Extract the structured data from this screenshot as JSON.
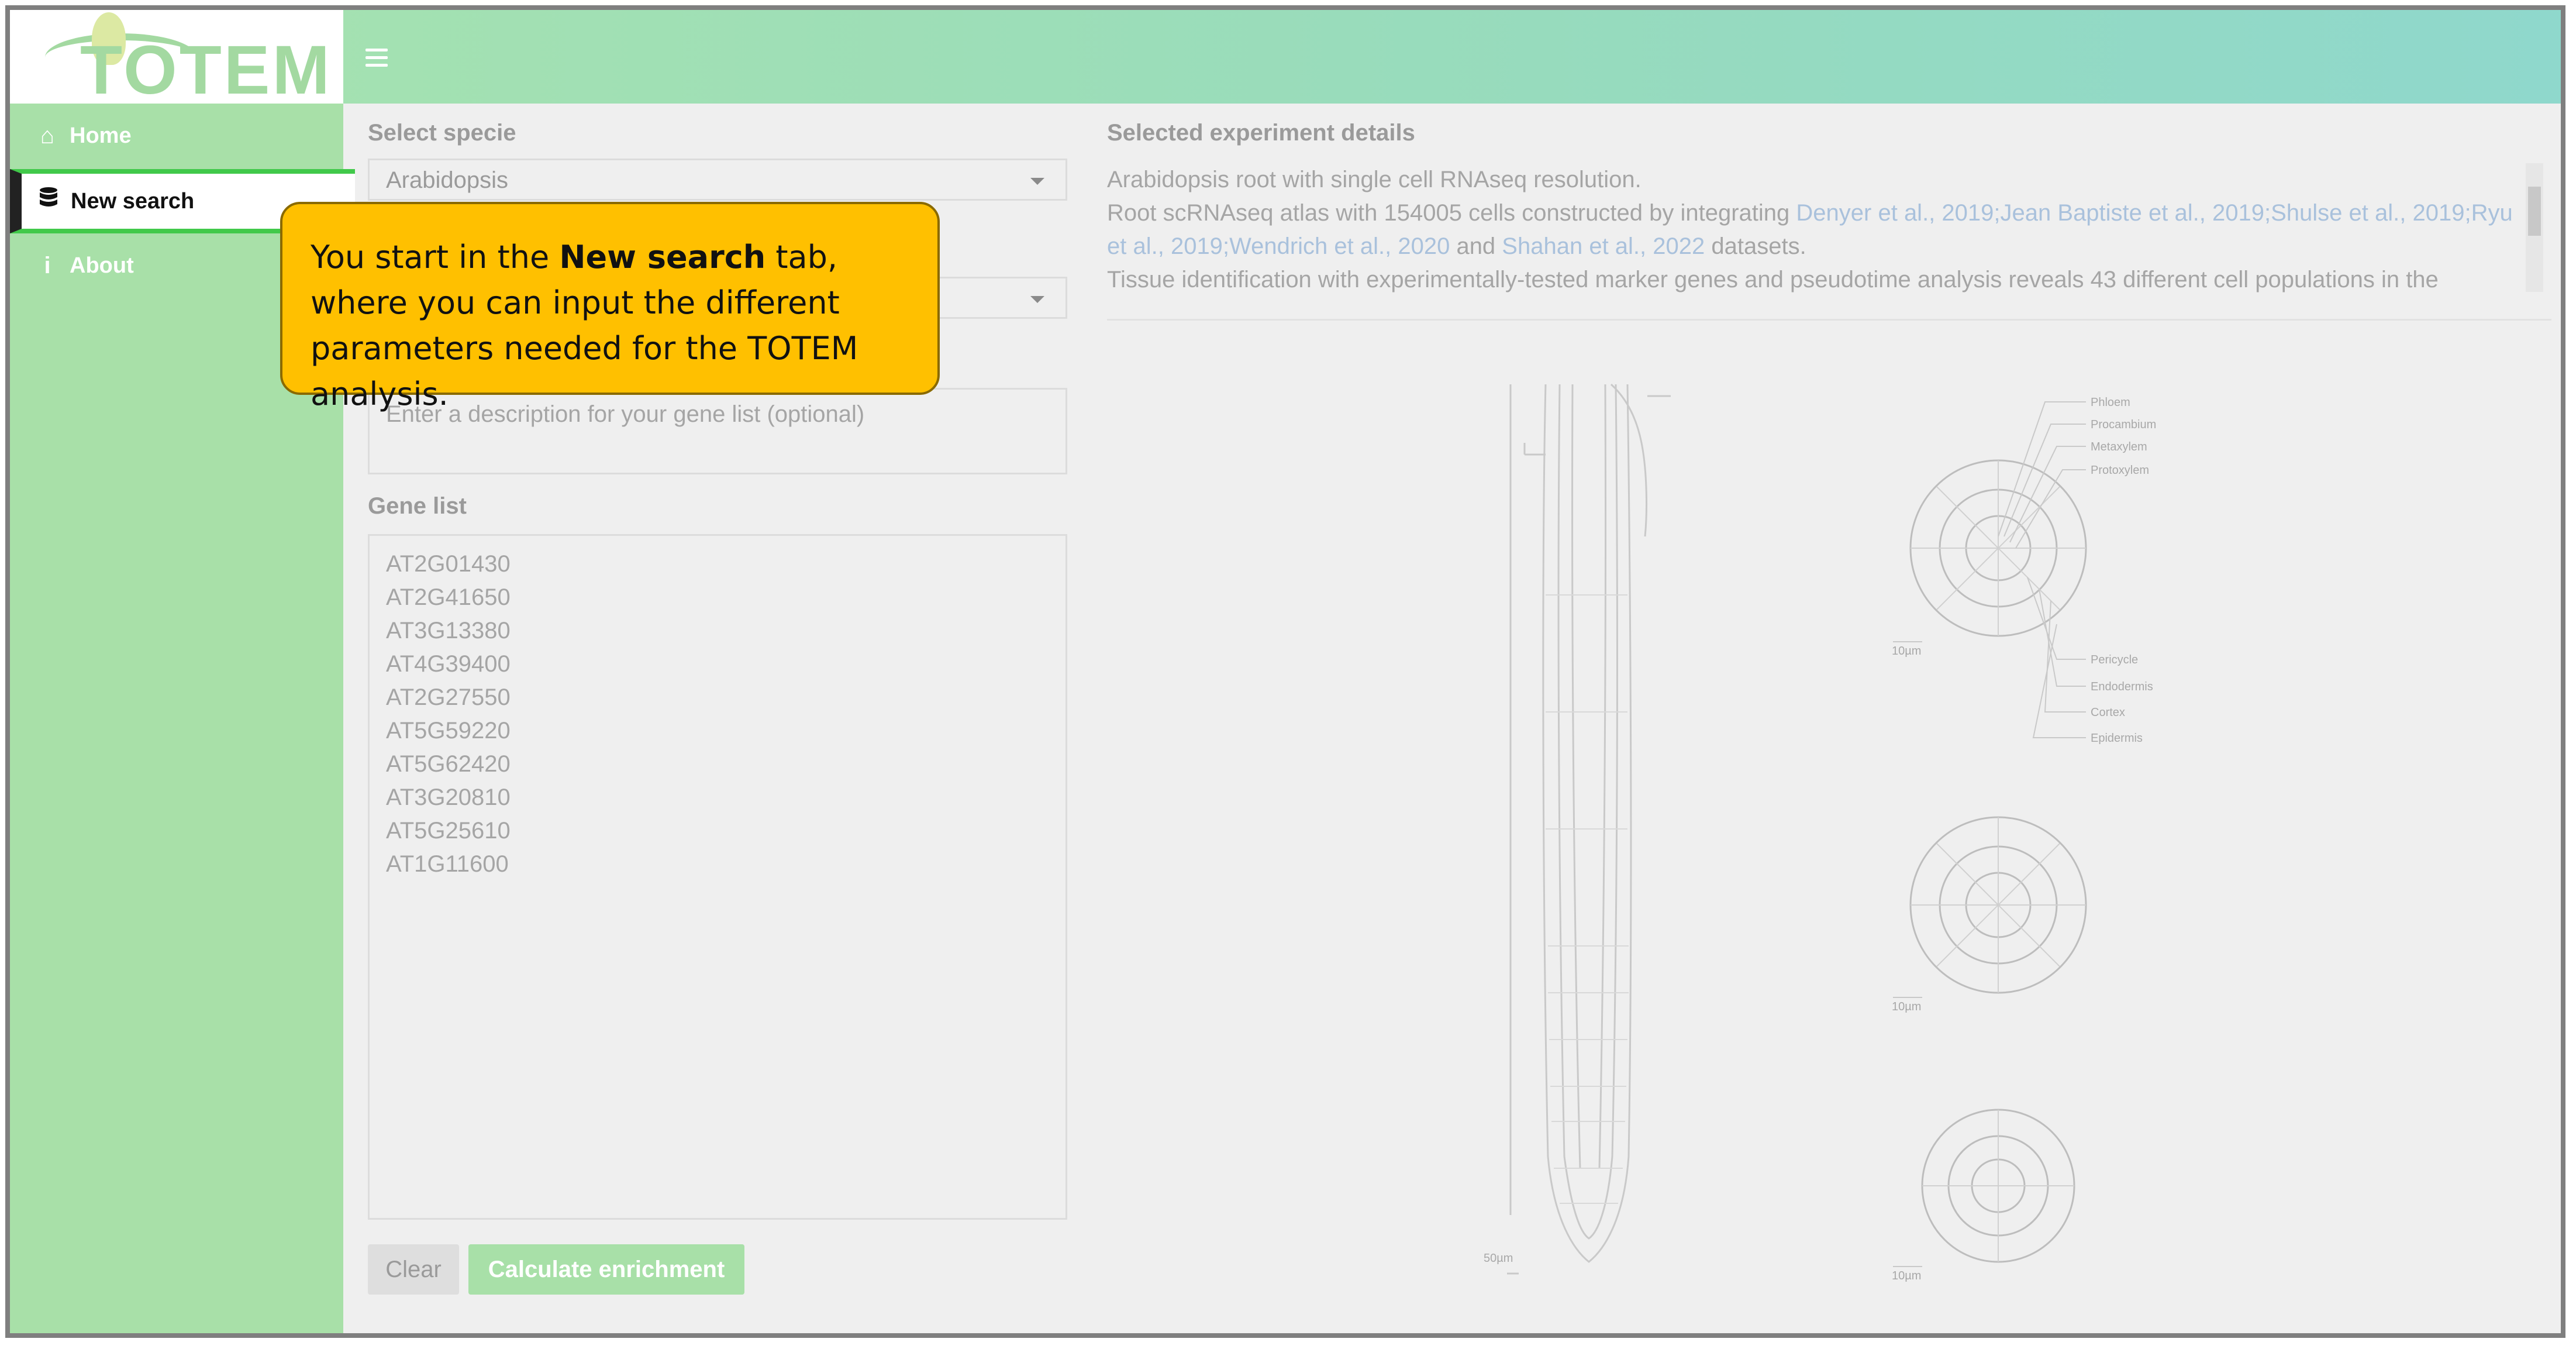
{
  "header": {
    "logo_text": "TOTEM",
    "menu_icon": "hamburger-icon"
  },
  "sidebar": {
    "items": [
      {
        "label": "Home",
        "icon": "home-icon"
      },
      {
        "label": "New search",
        "icon": "database-icon"
      },
      {
        "label": "About",
        "icon": "info-icon"
      }
    ]
  },
  "form": {
    "specie_label": "Select specie",
    "specie_value": "Arabidopsis",
    "description_placeholder": "Enter a description for your gene list (optional)",
    "gene_list_label": "Gene list",
    "genes": [
      "AT2G01430",
      "AT2G41650",
      "AT3G13380",
      "AT4G39400",
      "AT2G27550",
      "AT5G59220",
      "AT5G62420",
      "AT3G20810",
      "AT5G25610",
      "AT1G11600"
    ],
    "clear_label": "Clear",
    "calculate_label": "Calculate enrichment"
  },
  "details": {
    "title": "Selected experiment details",
    "line1": "Arabidopsis root with single cell RNAseq resolution.",
    "line2_prefix": "Root scRNAseq atlas with 154005 cells constructed by integrating ",
    "ref1": "Denyer et al., 2019",
    "ref_sep1": ";",
    "ref2": "Jean Baptiste et al., 2019",
    "ref_sep2": ";",
    "ref3": "Shulse et al., 2019",
    "ref_sep3": ";",
    "ref4": "Ryu et al., 2019",
    "ref_sep4": ";",
    "ref5": "Wendrich et al., 2020",
    "and_text": " and ",
    "ref6": "Shahan et al., 2022",
    "datasets_text": " datasets.",
    "line3": "Tissue identification with experimentally-tested marker genes and pseudotime analysis reveals 43 different cell populations in the"
  },
  "figure": {
    "layers": [
      "Phloem",
      "Procambium",
      "Metaxylem",
      "Protoxylem",
      "Pericycle",
      "Endodermis",
      "Cortex",
      "Epidermis"
    ],
    "scale_root": "50µm",
    "scale_sections": [
      "10µm",
      "10µm",
      "10µm"
    ]
  },
  "callout": {
    "text_before": "You start in the ",
    "text_bold": "New search",
    "text_after": " tab, where you can input the different parameters needed for the TOTEM analysis."
  },
  "colors": {
    "header_start": "#a7e3ae",
    "header_end": "#8fd8cc",
    "sidebar": "#a8e0a8",
    "active_border": "#41c94a",
    "callout": "#ffc000",
    "link": "#a9c1dc"
  }
}
